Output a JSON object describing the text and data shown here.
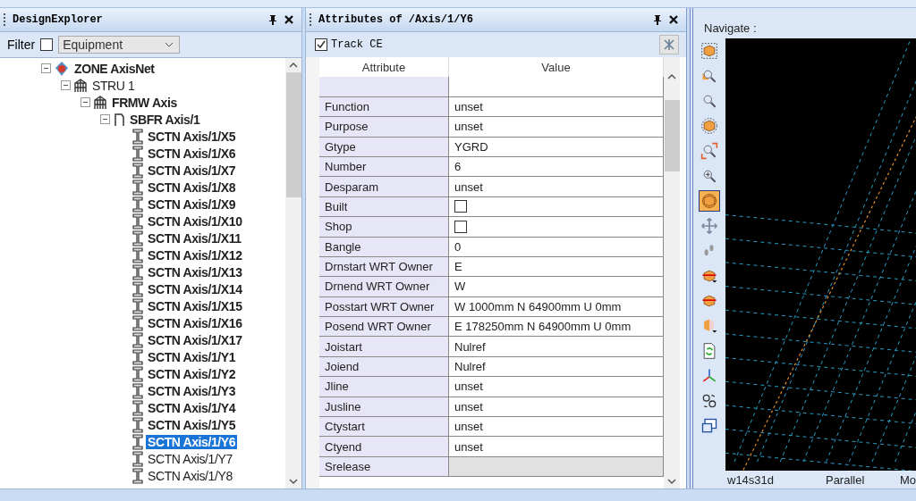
{
  "design_explorer": {
    "title": "DesignExplorer",
    "filter": {
      "label": "Filter",
      "checked": false,
      "value": "Equipment"
    },
    "tree": [
      {
        "label": "ZONE AxisNet",
        "kind": "zone",
        "bold": true,
        "expanded": true,
        "selected": false,
        "children": [
          {
            "label": "STRU 1",
            "kind": "stru",
            "bold": false,
            "expanded": true,
            "selected": false,
            "children": [
              {
                "label": "FRMW Axis",
                "kind": "frmw",
                "bold": true,
                "expanded": true,
                "selected": false,
                "children": [
                  {
                    "label": "SBFR Axis/1",
                    "kind": "sbfr",
                    "bold": true,
                    "expanded": true,
                    "selected": false,
                    "children": [
                      {
                        "label": "SCTN Axis/1/X5",
                        "kind": "sctn",
                        "bold": true,
                        "selected": false
                      },
                      {
                        "label": "SCTN Axis/1/X6",
                        "kind": "sctn",
                        "bold": true,
                        "selected": false
                      },
                      {
                        "label": "SCTN Axis/1/X7",
                        "kind": "sctn",
                        "bold": true,
                        "selected": false
                      },
                      {
                        "label": "SCTN Axis/1/X8",
                        "kind": "sctn",
                        "bold": true,
                        "selected": false
                      },
                      {
                        "label": "SCTN Axis/1/X9",
                        "kind": "sctn",
                        "bold": true,
                        "selected": false
                      },
                      {
                        "label": "SCTN Axis/1/X10",
                        "kind": "sctn",
                        "bold": true,
                        "selected": false
                      },
                      {
                        "label": "SCTN Axis/1/X11",
                        "kind": "sctn",
                        "bold": true,
                        "selected": false
                      },
                      {
                        "label": "SCTN Axis/1/X12",
                        "kind": "sctn",
                        "bold": true,
                        "selected": false
                      },
                      {
                        "label": "SCTN Axis/1/X13",
                        "kind": "sctn",
                        "bold": true,
                        "selected": false
                      },
                      {
                        "label": "SCTN Axis/1/X14",
                        "kind": "sctn",
                        "bold": true,
                        "selected": false
                      },
                      {
                        "label": "SCTN Axis/1/X15",
                        "kind": "sctn",
                        "bold": true,
                        "selected": false
                      },
                      {
                        "label": "SCTN Axis/1/X16",
                        "kind": "sctn",
                        "bold": true,
                        "selected": false
                      },
                      {
                        "label": "SCTN Axis/1/X17",
                        "kind": "sctn",
                        "bold": true,
                        "selected": false
                      },
                      {
                        "label": "SCTN Axis/1/Y1",
                        "kind": "sctn",
                        "bold": true,
                        "selected": false
                      },
                      {
                        "label": "SCTN Axis/1/Y2",
                        "kind": "sctn",
                        "bold": true,
                        "selected": false
                      },
                      {
                        "label": "SCTN Axis/1/Y3",
                        "kind": "sctn",
                        "bold": true,
                        "selected": false
                      },
                      {
                        "label": "SCTN Axis/1/Y4",
                        "kind": "sctn",
                        "bold": true,
                        "selected": false
                      },
                      {
                        "label": "SCTN Axis/1/Y5",
                        "kind": "sctn",
                        "bold": true,
                        "selected": false
                      },
                      {
                        "label": "SCTN Axis/1/Y6",
                        "kind": "sctn",
                        "bold": true,
                        "selected": true
                      },
                      {
                        "label": "SCTN Axis/1/Y7",
                        "kind": "sctn",
                        "bold": false,
                        "selected": false
                      },
                      {
                        "label": "SCTN Axis/1/Y8",
                        "kind": "sctn",
                        "bold": false,
                        "selected": false
                      }
                    ]
                  }
                ]
              }
            ]
          }
        ]
      }
    ]
  },
  "attributes": {
    "title": "Attributes of /Axis/1/Y6",
    "track_ce": {
      "label": "Track CE",
      "checked": true
    },
    "columns": [
      "Attribute",
      "Value"
    ],
    "rows": [
      {
        "attribute": "Function",
        "kind": "text",
        "value": "unset",
        "readonly": false
      },
      {
        "attribute": "Purpose",
        "kind": "text",
        "value": "unset",
        "readonly": false
      },
      {
        "attribute": "Gtype",
        "kind": "text",
        "value": "YGRD",
        "readonly": false
      },
      {
        "attribute": "Number",
        "kind": "text",
        "value": "6",
        "readonly": false
      },
      {
        "attribute": "Desparam",
        "kind": "text",
        "value": "unset",
        "readonly": false
      },
      {
        "attribute": "Built",
        "kind": "checkbox",
        "checked": false,
        "readonly": false
      },
      {
        "attribute": "Shop",
        "kind": "checkbox",
        "checked": false,
        "readonly": false
      },
      {
        "attribute": "Bangle",
        "kind": "text",
        "value": "0",
        "readonly": false
      },
      {
        "attribute": "Drnstart WRT Owner",
        "kind": "text",
        "value": "E",
        "readonly": false
      },
      {
        "attribute": "Drnend WRT Owner",
        "kind": "text",
        "value": "W",
        "readonly": false
      },
      {
        "attribute": "Posstart WRT Owner",
        "kind": "text",
        "value": "W 1000mm N 64900mm U 0mm",
        "readonly": false
      },
      {
        "attribute": "Posend WRT Owner",
        "kind": "text",
        "value": "E 178250mm N 64900mm U 0mm",
        "readonly": false
      },
      {
        "attribute": "Joistart",
        "kind": "text",
        "value": "Nulref",
        "readonly": false
      },
      {
        "attribute": "Joiend",
        "kind": "text",
        "value": "Nulref",
        "readonly": false
      },
      {
        "attribute": "Jline",
        "kind": "text",
        "value": "unset",
        "readonly": false
      },
      {
        "attribute": "Jusline",
        "kind": "text",
        "value": "unset",
        "readonly": false
      },
      {
        "attribute": "Ctystart",
        "kind": "text",
        "value": "unset",
        "readonly": false
      },
      {
        "attribute": "Ctyend",
        "kind": "text",
        "value": "unset",
        "readonly": false
      },
      {
        "attribute": "Srelease",
        "kind": "text",
        "value": "",
        "readonly": true
      }
    ]
  },
  "navigate": {
    "title": "Navigate :",
    "tools": [
      {
        "kind": "limits",
        "active": false
      },
      {
        "kind": "zoom-box",
        "active": false
      },
      {
        "kind": "zoom-find",
        "active": false
      },
      {
        "kind": "isometric",
        "active": false
      },
      {
        "kind": "zoom-fit",
        "active": false
      },
      {
        "kind": "zoom-in",
        "active": false
      },
      {
        "kind": "rotate",
        "active": true
      },
      {
        "kind": "pan",
        "active": false
      },
      {
        "kind": "walk",
        "active": false
      },
      {
        "kind": "clip",
        "active": false
      },
      {
        "kind": "clip-ce",
        "active": false
      },
      {
        "kind": "section",
        "active": false
      },
      {
        "kind": "refresh",
        "active": false
      },
      {
        "kind": "axes",
        "active": false
      },
      {
        "kind": "orbit",
        "active": false
      },
      {
        "kind": "windows",
        "active": false
      }
    ],
    "status": [
      "w14s31d",
      "Parallel",
      "Mo"
    ]
  }
}
